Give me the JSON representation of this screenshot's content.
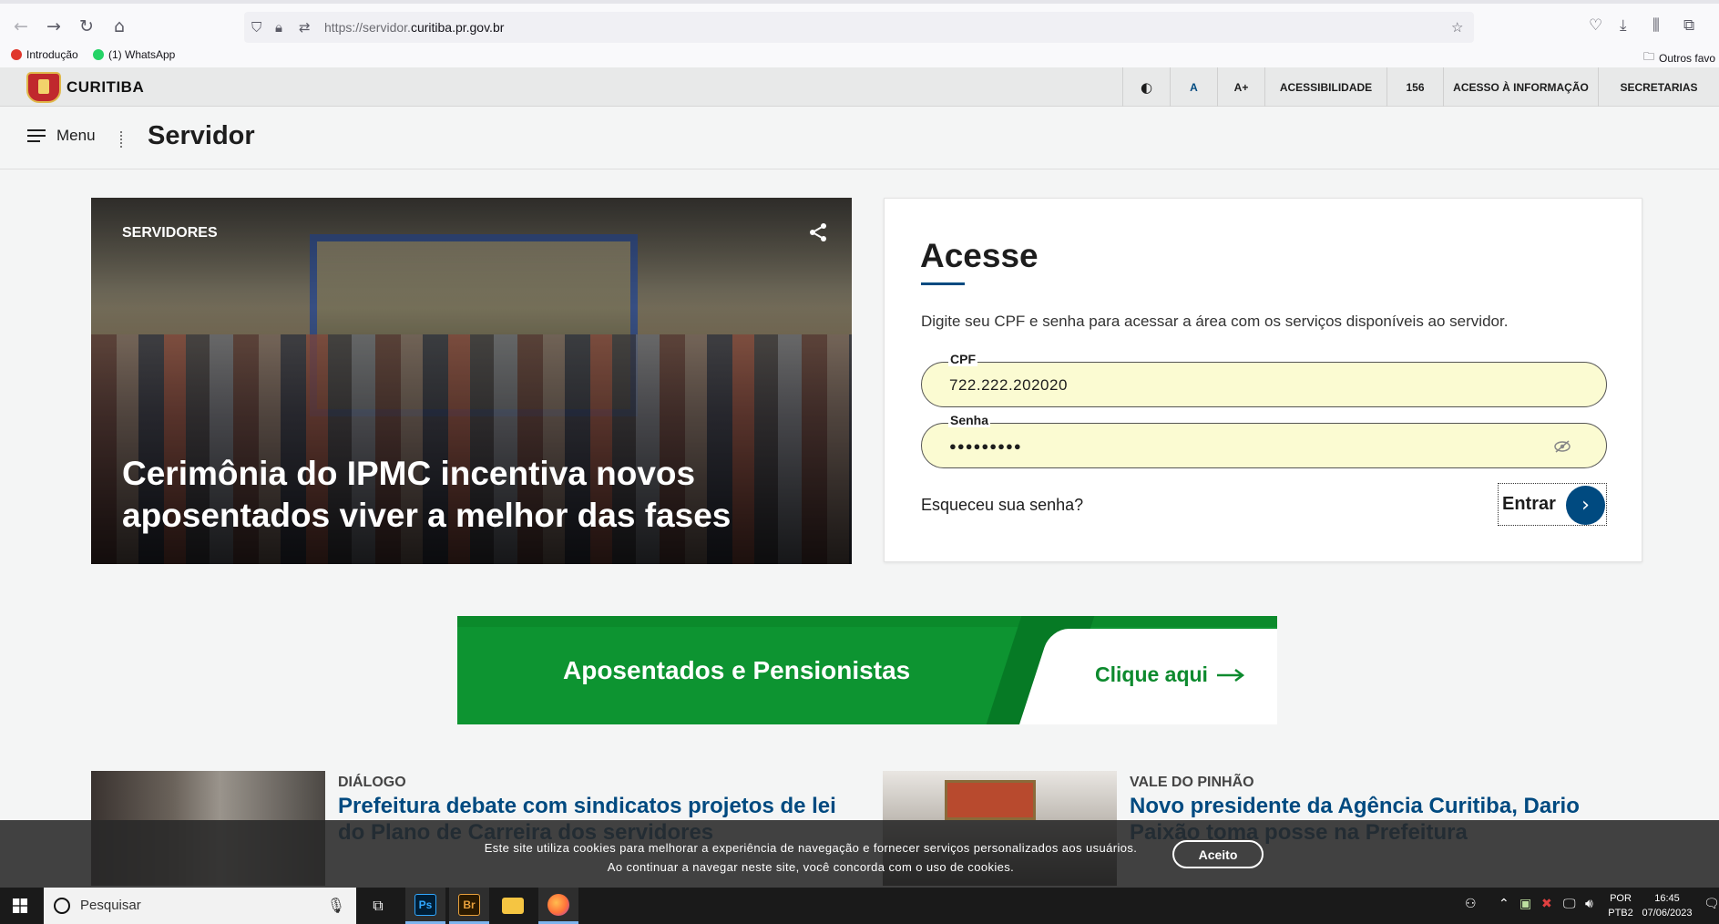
{
  "browser": {
    "url_prefix": "https://servidor.",
    "url_domain": "curitiba.pr.gov.br",
    "bookmarks": [
      {
        "label": "Introdução"
      },
      {
        "label": "(1) WhatsApp"
      }
    ],
    "other_bookmarks": "Outros favo"
  },
  "topbar": {
    "logo_text": "CURITIBA",
    "items": {
      "contrast_icon": "◐",
      "font_normal": "A",
      "font_plus": "A+",
      "accessibility": "ACESSIBILIDADE",
      "phone": "156",
      "info_access": "ACESSO À INFORMAÇÃO",
      "departments": "SECRETARIAS"
    },
    "accent_color": "#004a80"
  },
  "header": {
    "menu_label": "Menu",
    "title": "Servidor"
  },
  "hero": {
    "tag": "SERVIDORES",
    "title": "Cerimônia do IPMC incentiva novos aposentados viver a melhor das fases"
  },
  "login": {
    "title": "Acesse",
    "description": "Digite seu CPF e senha para acessar a área com os serviços disponíveis ao servidor.",
    "cpf_label": "CPF",
    "cpf_value": "722.222.202020",
    "password_label": "Senha",
    "password_value": "●●●●●●●●●",
    "forgot_label": "Esqueceu sua senha?",
    "submit_label": "Entrar"
  },
  "banner": {
    "title": "Aposentados e Pensionistas",
    "link_label": "Clique aqui",
    "color": "#0d9431"
  },
  "news": [
    {
      "category": "DIÁLOGO",
      "title": "Prefeitura debate com sindicatos projetos de lei do Plano de Carreira dos servidores"
    },
    {
      "category": "VALE DO PINHÃO",
      "title": "Novo presidente da Agência Curitiba, Dario Paixão toma posse na Prefeitura"
    }
  ],
  "cookie": {
    "line1": "Este site utiliza cookies para melhorar a experiência de navegação e fornecer serviços personalizados aos usuários.",
    "line2": "Ao continuar a navegar neste site, você concorda com o uso de cookies.",
    "accept_label": "Aceito"
  },
  "taskbar": {
    "search_placeholder": "Pesquisar",
    "apps": [
      {
        "name": "photoshop",
        "label": "Ps"
      },
      {
        "name": "bridge",
        "label": "Br"
      }
    ],
    "lang_top": "POR",
    "lang_bottom": "PTB2",
    "time": "16:45",
    "date": "07/06/2023"
  }
}
